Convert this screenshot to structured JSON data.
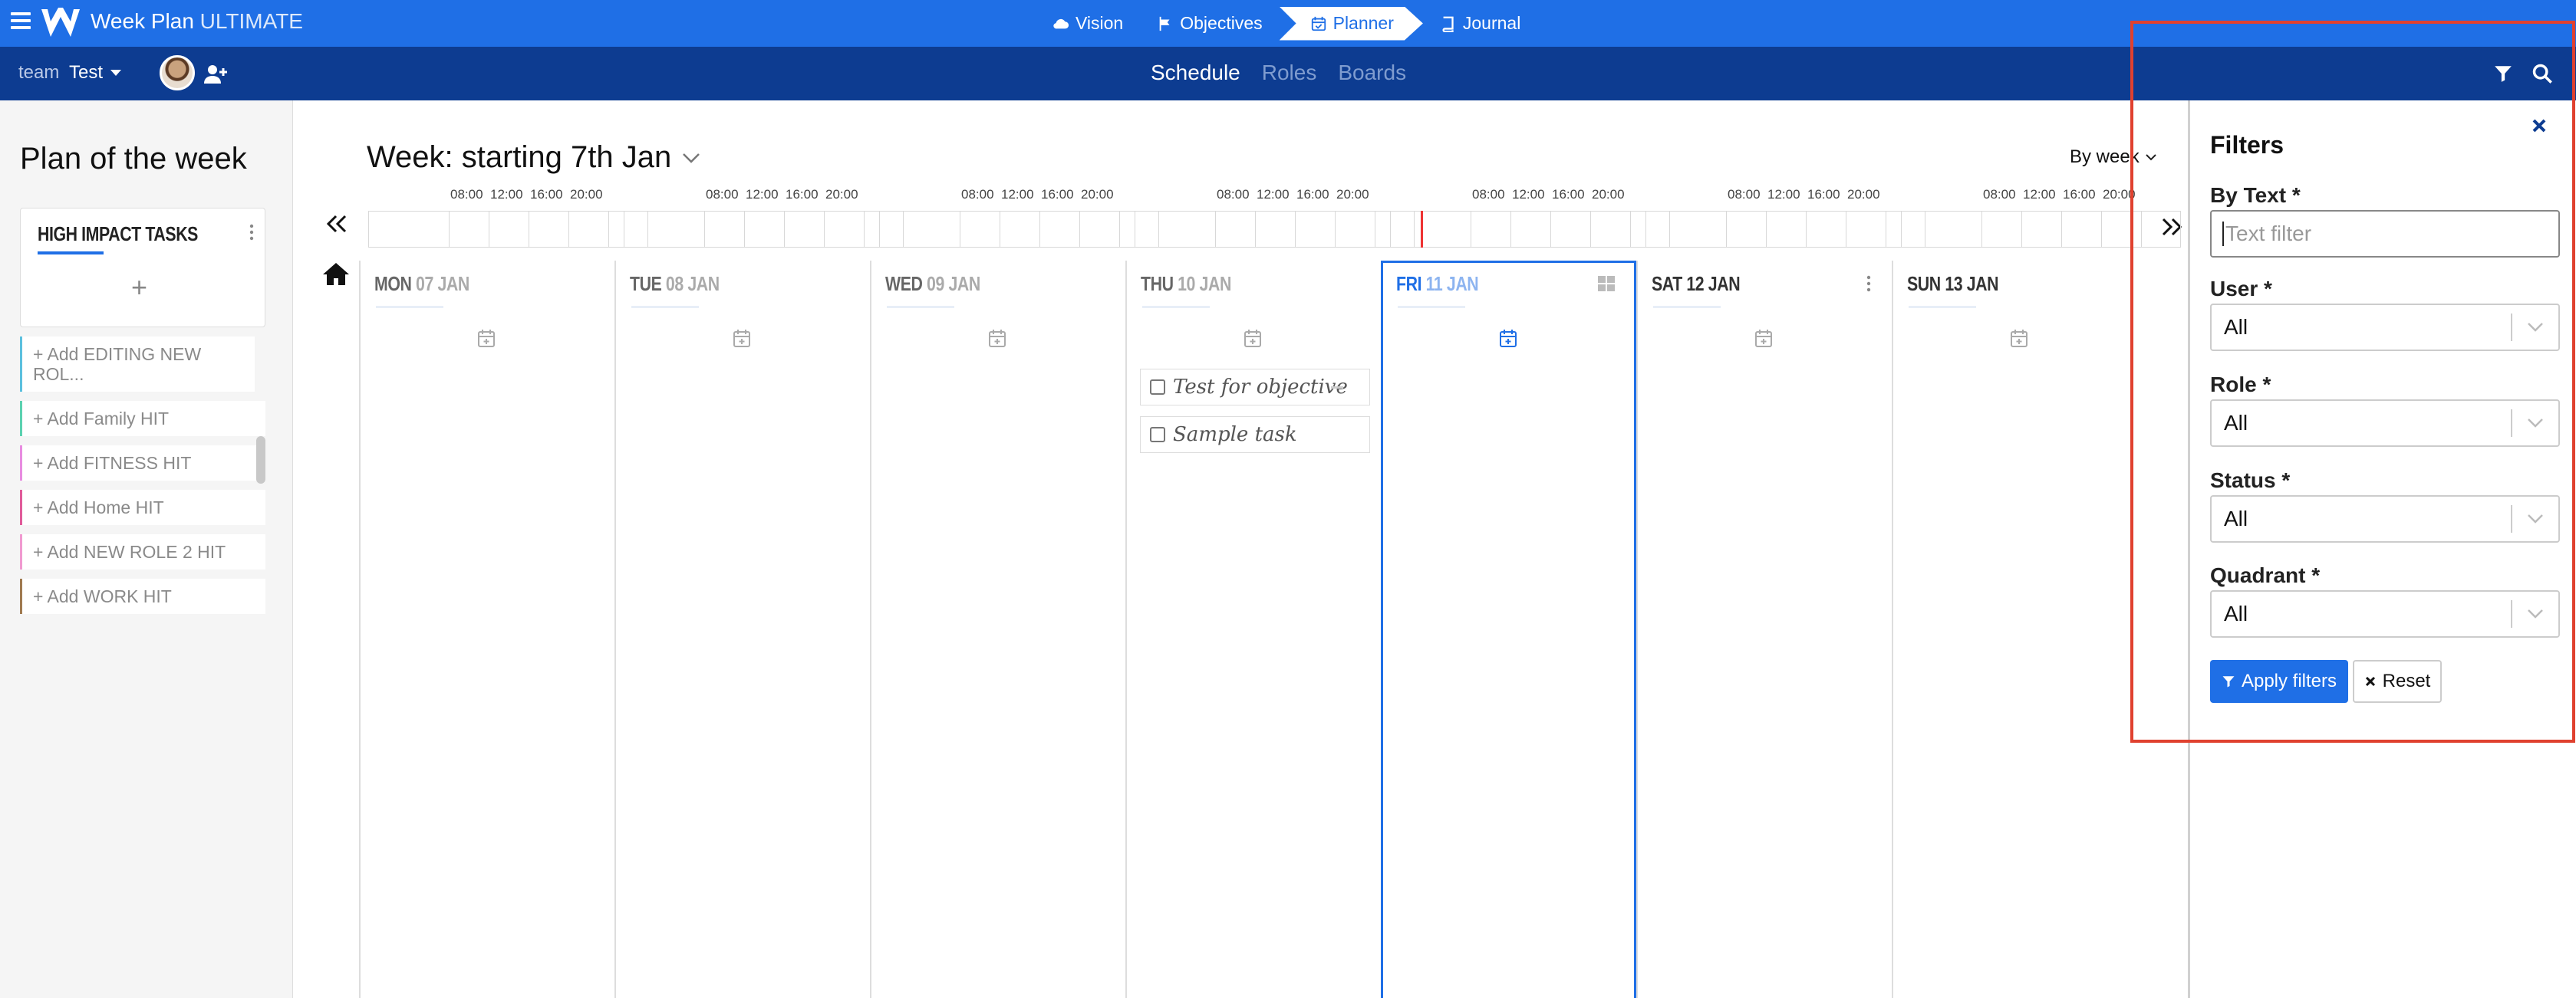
{
  "app": {
    "brand_main": "Week Plan",
    "brand_edition": "ULTIMATE"
  },
  "topnav": [
    {
      "label": "Vision",
      "icon": "cloud-icon"
    },
    {
      "label": "Objectives",
      "icon": "flag-icon"
    },
    {
      "label": "Planner",
      "icon": "calendar-check-icon",
      "active": true
    },
    {
      "label": "Journal",
      "icon": "book-icon"
    }
  ],
  "subbar": {
    "team_label": "team",
    "team_name": "Test",
    "tabs": [
      "Schedule",
      "Roles",
      "Boards"
    ],
    "active_tab": "Schedule"
  },
  "sidebar": {
    "title": "Plan of the week",
    "hit_card_title": "HIGH IMPACT TASKS",
    "roles": [
      {
        "label": "+ Add EDITING NEW ROL...",
        "color": "#5bc0de"
      },
      {
        "label": "+ Add Family HIT",
        "color": "#5bd1b0"
      },
      {
        "label": "+ Add FITNESS HIT",
        "color": "#e88ce0"
      },
      {
        "label": "+ Add Home HIT",
        "color": "#e05b9a"
      },
      {
        "label": "+ Add NEW ROLE 2 HIT",
        "color": "#f09ad0"
      },
      {
        "label": "+ Add WORK HIT",
        "color": "#a07a50"
      }
    ]
  },
  "main": {
    "week_title": "Week: starting 7th Jan",
    "view_select": "By week",
    "time_labels": [
      "08:00",
      "12:00",
      "16:00",
      "20:00"
    ],
    "days": [
      {
        "name": "MON",
        "date": "07 JAN"
      },
      {
        "name": "TUE",
        "date": "08 JAN"
      },
      {
        "name": "WED",
        "date": "09 JAN"
      },
      {
        "name": "THU",
        "date": "10 JAN"
      },
      {
        "name": "FRI",
        "date": "11 JAN",
        "today": true
      },
      {
        "name": "SAT",
        "date": "12 JAN"
      },
      {
        "name": "SUN",
        "date": "13 JAN"
      }
    ],
    "tasks": [
      {
        "day": "THU",
        "label": "Test for objective"
      },
      {
        "day": "THU",
        "label": "Sample task"
      }
    ]
  },
  "filters": {
    "title": "Filters",
    "by_text_label": "By Text *",
    "text_placeholder": "Text filter",
    "user_label": "User *",
    "user_value": "All",
    "role_label": "Role *",
    "role_value": "All",
    "status_label": "Status *",
    "status_value": "All",
    "quadrant_label": "Quadrant *",
    "quadrant_value": "All",
    "apply_label": "Apply filters",
    "reset_label": "Reset"
  },
  "colors": {
    "primary": "#1f6fe6",
    "navy": "#0d3c91",
    "highlight": "#e0412f"
  }
}
